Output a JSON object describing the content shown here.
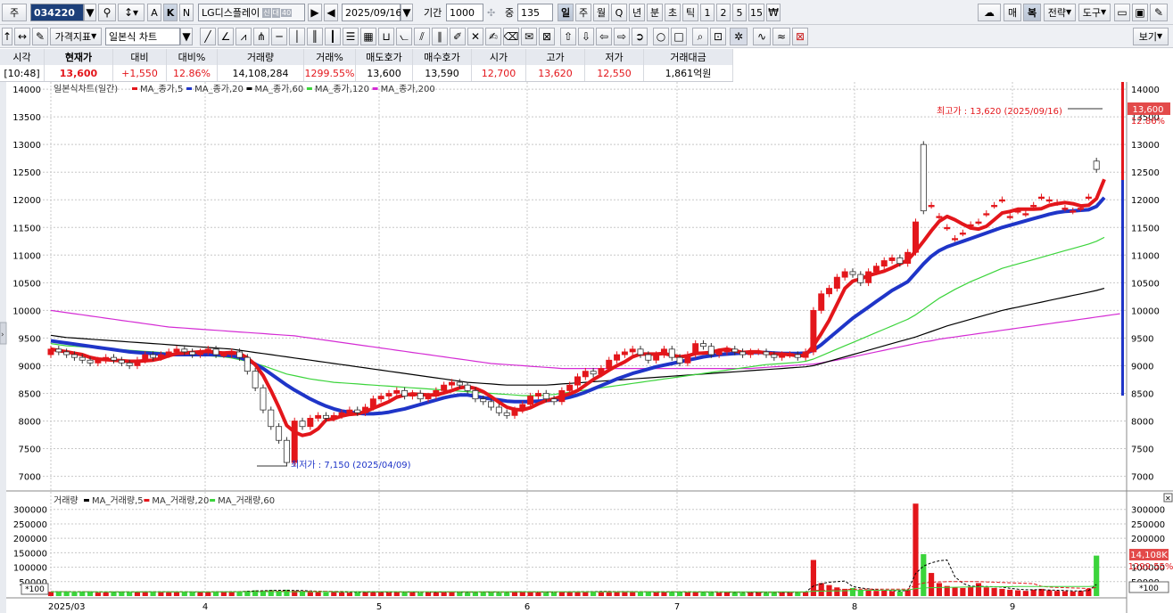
{
  "toolbar": {
    "mode_label": "주",
    "code": "034220",
    "name": "LG디스플레이",
    "name_badges": [
      "신",
      "대",
      "40"
    ],
    "date": "2025/09/16",
    "period_label": "기간",
    "period_value": "1000",
    "count_label": "중",
    "count_value": "135",
    "letters": [
      "A",
      "K",
      "N"
    ],
    "timeframes": [
      "일",
      "주",
      "월",
      "Q",
      "년",
      "분",
      "초",
      "틱",
      "1",
      "2",
      "5",
      "15"
    ],
    "right_buttons": [
      "매",
      "복",
      "전략",
      "도구"
    ],
    "view_button": "보기"
  },
  "toolbar2": {
    "indicator_button": "가격지표",
    "chart_select": "일본식 차트"
  },
  "quote": {
    "headers": [
      "시각",
      "현재가",
      "대비",
      "대비%",
      "거래량",
      "거래%",
      "매도호가",
      "매수호가",
      "시가",
      "고가",
      "저가",
      "거래대금"
    ],
    "values": [
      "[10:48]",
      "13,600",
      "+1,550",
      "12.86%",
      "14,108,284",
      "1299.55%",
      "13,600",
      "13,590",
      "12,700",
      "13,620",
      "12,550",
      "1,861억원"
    ]
  },
  "colors": {
    "up": "#e3161b",
    "down": "#1f35c8",
    "ma5": "#e3161b",
    "ma20": "#1f35c8",
    "ma60": "#3bd43b",
    "ma120": "#000000",
    "ma200": "#d42bd4",
    "grid": "#c8c8c8"
  },
  "price_panel": {
    "legend_title": "일본식차트(일간)",
    "legend_items": [
      "MA_종가,5",
      "MA_종가,20",
      "MA_종가,60",
      "MA_종가,120",
      "MA_종가,200"
    ],
    "y_ticks": [
      14000,
      13500,
      13000,
      12500,
      12000,
      11500,
      11000,
      10500,
      10000,
      9500,
      9000,
      8500,
      8000,
      7500,
      7000
    ],
    "high_annotation": "최고가 : 13,620 (2025/09/16)",
    "low_annotation": "최저가 : 7,150 (2025/04/09)",
    "last_price_tag": "13,600",
    "last_change_tag": "12.86%"
  },
  "volume_panel": {
    "legend_title": "거래량",
    "legend_items": [
      "MA_거래량,5",
      "MA_거래량,20",
      "MA_거래량,60"
    ],
    "y_ticks": [
      "300000",
      "250000",
      "200000",
      "150000",
      "100000",
      "50000"
    ],
    "unit_label": "*100",
    "volume_tag": "14,108K",
    "volume_pct_tag": "1299.55%"
  },
  "x_axis": {
    "labels": [
      "2025/03",
      "4",
      "5",
      "6",
      "7",
      "8",
      "9"
    ]
  },
  "chart_data": {
    "type": "candlestick",
    "x_start": "2025/03",
    "x_end": "2025/09/16",
    "ylim": [
      6800,
      14050
    ],
    "vol_ylim": [
      0,
      330000
    ],
    "closes": [
      9300,
      9250,
      9200,
      9150,
      9100,
      9050,
      9100,
      9150,
      9100,
      9050,
      9000,
      9100,
      9200,
      9150,
      9200,
      9250,
      9300,
      9250,
      9200,
      9250,
      9300,
      9200,
      9200,
      9250,
      9150,
      8900,
      8600,
      8200,
      7900,
      7650,
      7250,
      8000,
      7900,
      8050,
      8100,
      8050,
      8100,
      8150,
      8200,
      8150,
      8250,
      8400,
      8450,
      8500,
      8550,
      8450,
      8500,
      8400,
      8450,
      8550,
      8650,
      8700,
      8650,
      8550,
      8400,
      8350,
      8250,
      8150,
      8100,
      8200,
      8300,
      8450,
      8500,
      8400,
      8350,
      8550,
      8650,
      8800,
      8900,
      8850,
      8950,
      9100,
      9200,
      9250,
      9300,
      9200,
      9100,
      9200,
      9300,
      9150,
      9050,
      9200,
      9400,
      9350,
      9200,
      9250,
      9300,
      9250,
      9200,
      9250,
      9250,
      9200,
      9150,
      9200,
      9200,
      9150,
      9250,
      10000,
      10300,
      10400,
      10600,
      10700,
      10650,
      10500,
      10700,
      10800,
      10900,
      10950,
      10850,
      11050,
      11600,
      11800,
      11900,
      11700,
      11500,
      11300,
      11400,
      11550,
      11600,
      11750,
      11900,
      12000,
      11700,
      11800,
      11750,
      11900,
      12050,
      12000,
      11950,
      11850,
      11800,
      11850,
      12050,
      12550,
      13600
    ],
    "opens": [
      9200,
      9300,
      9250,
      9200,
      9150,
      9100,
      9050,
      9100,
      9150,
      9100,
      9050,
      9000,
      9100,
      9200,
      9150,
      9200,
      9250,
      9300,
      9250,
      9200,
      9250,
      9300,
      9200,
      9200,
      9250,
      9150,
      8900,
      8600,
      8200,
      7900,
      7650,
      7250,
      8000,
      7900,
      8050,
      8100,
      8050,
      8100,
      8150,
      8200,
      8150,
      8250,
      8400,
      8450,
      8500,
      8550,
      8450,
      8500,
      8400,
      8450,
      8550,
      8650,
      8700,
      8650,
      8550,
      8400,
      8350,
      8250,
      8150,
      8100,
      8200,
      8300,
      8450,
      8500,
      8400,
      8350,
      8550,
      8650,
      8800,
      8900,
      8850,
      8950,
      9100,
      9200,
      9250,
      9300,
      9200,
      9100,
      9200,
      9300,
      9150,
      9050,
      9200,
      9400,
      9350,
      9200,
      9250,
      9300,
      9250,
      9200,
      9250,
      9250,
      9200,
      9150,
      9200,
      9200,
      9150,
      9250,
      10000,
      10300,
      10400,
      10600,
      10700,
      10650,
      10500,
      10700,
      10800,
      10900,
      10950,
      10850,
      11050,
      13000,
      11900,
      11700,
      11500,
      11300,
      11400,
      11550,
      11600,
      11750,
      11900,
      12000,
      11700,
      11800,
      11750,
      11900,
      12050,
      12000,
      11950,
      11850,
      11800,
      11850,
      12050,
      12700
    ],
    "ma200": [
      10000,
      9980,
      9960,
      9940,
      9920,
      9900,
      9880,
      9860,
      9840,
      9820,
      9800,
      9780,
      9760,
      9740,
      9720,
      9700,
      9690,
      9680,
      9670,
      9660,
      9650,
      9640,
      9630,
      9620,
      9610,
      9600,
      9590,
      9580,
      9570,
      9560,
      9550,
      9540,
      9520,
      9500,
      9480,
      9460,
      9440,
      9420,
      9400,
      9380,
      9360,
      9340,
      9320,
      9300,
      9280,
      9260,
      9240,
      9220,
      9200,
      9180,
      9160,
      9140,
      9120,
      9100,
      9080,
      9060,
      9040,
      9030,
      9020,
      9010,
      9000,
      8990,
      8980,
      8970,
      8960,
      8950,
      8950,
      8950,
      8950,
      8950,
      8950,
      8950,
      8950,
      8950,
      8950,
      8950,
      8950,
      8950,
      8950,
      8950,
      8950,
      8950,
      8950,
      8950,
      8950,
      8950,
      8950,
      8950,
      8950,
      8950,
      8960,
      8970,
      8980,
      8990,
      9000,
      9010,
      9020,
      9030,
      9050,
      9080,
      9100,
      9130,
      9160,
      9190,
      9220,
      9250,
      9280,
      9310,
      9340,
      9370,
      9400,
      9430,
      9450,
      9480,
      9500,
      9520,
      9540,
      9560,
      9580,
      9600,
      9620,
      9640,
      9660,
      9680,
      9700,
      9720,
      9740,
      9760,
      9780,
      9800,
      9820,
      9840,
      9860,
      9880,
      9900,
      9920,
      9940
    ],
    "ma120": [
      9550,
      9530,
      9510,
      9500,
      9490,
      9480,
      9470,
      9460,
      9450,
      9440,
      9430,
      9420,
      9410,
      9400,
      9390,
      9380,
      9370,
      9360,
      9350,
      9340,
      9330,
      9320,
      9310,
      9300,
      9280,
      9260,
      9240,
      9220,
      9200,
      9180,
      9160,
      9140,
      9120,
      9100,
      9080,
      9060,
      9040,
      9020,
      9000,
      8980,
      8960,
      8940,
      8920,
      8900,
      8880,
      8860,
      8840,
      8820,
      8800,
      8780,
      8760,
      8740,
      8720,
      8700,
      8690,
      8680,
      8670,
      8660,
      8650,
      8650,
      8650,
      8650,
      8650,
      8650,
      8660,
      8670,
      8680,
      8690,
      8700,
      8710,
      8720,
      8730,
      8740,
      8750,
      8760,
      8770,
      8780,
      8790,
      8800,
      8810,
      8820,
      8830,
      8840,
      8850,
      8860,
      8870,
      8880,
      8890,
      8900,
      8910,
      8920,
      8930,
      8940,
      8950,
      8960,
      8970,
      8980,
      9000,
      9040,
      9080,
      9120,
      9160,
      9200,
      9240,
      9280,
      9320,
      9360,
      9400,
      9440,
      9480,
      9520,
      9570,
      9620,
      9670,
      9720,
      9760,
      9800,
      9840,
      9880,
      9920,
      9960,
      10000,
      10030,
      10060,
      10090,
      10120,
      10150,
      10180,
      10210,
      10240,
      10270,
      10300,
      10330,
      10360,
      10400
    ],
    "ma60": [
      9400,
      9380,
      9360,
      9350,
      9340,
      9330,
      9320,
      9310,
      9300,
      9290,
      9280,
      9270,
      9260,
      9250,
      9240,
      9230,
      9220,
      9210,
      9200,
      9190,
      9180,
      9170,
      9160,
      9140,
      9110,
      9080,
      9040,
      9000,
      8950,
      8900,
      8850,
      8820,
      8790,
      8760,
      8740,
      8720,
      8700,
      8690,
      8680,
      8670,
      8660,
      8650,
      8640,
      8630,
      8620,
      8610,
      8600,
      8590,
      8580,
      8570,
      8560,
      8550,
      8540,
      8530,
      8520,
      8510,
      8500,
      8490,
      8480,
      8470,
      8460,
      8460,
      8460,
      8470,
      8480,
      8500,
      8520,
      8540,
      8560,
      8580,
      8600,
      8620,
      8640,
      8660,
      8680,
      8700,
      8720,
      8740,
      8760,
      8780,
      8800,
      8820,
      8840,
      8860,
      8880,
      8900,
      8920,
      8940,
      8960,
      8980,
      9000,
      9020,
      9030,
      9040,
      9050,
      9060,
      9080,
      9120,
      9180,
      9240,
      9300,
      9360,
      9420,
      9480,
      9540,
      9600,
      9660,
      9720,
      9780,
      9840,
      9920,
      10020,
      10120,
      10220,
      10300,
      10380,
      10450,
      10520,
      10580,
      10640,
      10700,
      10760,
      10800,
      10840,
      10880,
      10920,
      10960,
      11000,
      11040,
      11080,
      11120,
      11160,
      11200,
      11250,
      11320
    ],
    "ma20": [
      9450,
      9430,
      9410,
      9390,
      9370,
      9350,
      9330,
      9310,
      9290,
      9270,
      9250,
      9240,
      9230,
      9220,
      9210,
      9200,
      9200,
      9200,
      9200,
      9200,
      9200,
      9200,
      9190,
      9180,
      9150,
      9100,
      9030,
      8950,
      8850,
      8750,
      8650,
      8560,
      8480,
      8400,
      8330,
      8270,
      8220,
      8180,
      8160,
      8140,
      8130,
      8130,
      8140,
      8160,
      8190,
      8220,
      8260,
      8300,
      8340,
      8380,
      8420,
      8450,
      8470,
      8470,
      8450,
      8420,
      8400,
      8380,
      8360,
      8350,
      8350,
      8350,
      8360,
      8370,
      8380,
      8400,
      8430,
      8470,
      8520,
      8580,
      8640,
      8700,
      8760,
      8810,
      8860,
      8900,
      8940,
      8980,
      9010,
      9040,
      9070,
      9100,
      9130,
      9160,
      9180,
      9200,
      9210,
      9220,
      9230,
      9240,
      9240,
      9240,
      9230,
      9220,
      9220,
      9220,
      9230,
      9280,
      9380,
      9500,
      9620,
      9740,
      9860,
      9960,
      10060,
      10160,
      10260,
      10360,
      10440,
      10520,
      10680,
      10840,
      10980,
      11080,
      11150,
      11200,
      11250,
      11300,
      11350,
      11400,
      11450,
      11500,
      11540,
      11580,
      11620,
      11660,
      11700,
      11740,
      11770,
      11790,
      11800,
      11810,
      11820,
      11880,
      12040
    ],
    "volumes": [
      15000,
      14000,
      16000,
      13000,
      15000,
      14000,
      12000,
      13000,
      14000,
      15000,
      13000,
      14000,
      16000,
      15000,
      14000,
      13000,
      15000,
      14000,
      13000,
      14000,
      15000,
      16000,
      14000,
      15000,
      17000,
      18000,
      20000,
      19000,
      21000,
      18000,
      22000,
      19000,
      16000,
      15000,
      14000,
      13000,
      14000,
      13000,
      12000,
      13000,
      14000,
      15000,
      14000,
      13000,
      14000,
      15000,
      13000,
      12000,
      13000,
      14000,
      15000,
      14000,
      13000,
      12000,
      14000,
      15000,
      13000,
      12000,
      14000,
      16000,
      15000,
      14000,
      13000,
      12000,
      13000,
      14000,
      16000,
      15000,
      14000,
      15000,
      16000,
      17000,
      15000,
      14000,
      16000,
      15000,
      14000,
      13000,
      14000,
      15000,
      14000,
      13000,
      14000,
      15000,
      13000,
      12000,
      14000,
      13000,
      12000,
      14000,
      13000,
      12000,
      14000,
      13000,
      12000,
      14000,
      15000,
      125000,
      45000,
      38000,
      30000,
      25000,
      28000,
      22000,
      20000,
      18000,
      19000,
      17000,
      16000,
      22000,
      320000,
      145000,
      80000,
      45000,
      35000,
      30000,
      28000,
      32000,
      45000,
      30000,
      28000,
      25000,
      22000,
      20000,
      18000,
      22000,
      25000,
      20000,
      18000,
      17000,
      16000,
      18000,
      25000,
      140000
    ],
    "vol_ma5": [
      15000,
      15000,
      15000,
      14500,
      14500,
      14500,
      14000,
      14000,
      14000,
      14000,
      14000,
      14000,
      14500,
      14500,
      14500,
      14500,
      14500,
      14500,
      14000,
      14000,
      14000,
      14500,
      14500,
      15000,
      15500,
      16500,
      17500,
      18500,
      19500,
      20000,
      20000,
      19500,
      19000,
      18000,
      17000,
      15500,
      14500,
      14000,
      13500,
      13500,
      13500,
      14000,
      14000,
      14000,
      14000,
      14000,
      14000,
      13500,
      13500,
      13500,
      14000,
      14000,
      13500,
      13500,
      13500,
      14000,
      14000,
      13500,
      13500,
      14500,
      15000,
      14500,
      14000,
      13500,
      13500,
      14000,
      14500,
      15000,
      15000,
      15500,
      16000,
      16000,
      15500,
      15500,
      15500,
      15000,
      14500,
      14000,
      14000,
      14500,
      14000,
      14000,
      14000,
      14000,
      13500,
      13500,
      13500,
      13000,
      13000,
      13000,
      13000,
      13000,
      13000,
      13000,
      13000,
      13500,
      14000,
      35000,
      43000,
      48000,
      50000,
      52000,
      33000,
      28000,
      25000,
      22000,
      20000,
      19000,
      18000,
      19000,
      78000,
      104000,
      115000,
      122000,
      125000,
      67000,
      44000,
      34000,
      34000,
      33000,
      32000,
      31000,
      27000,
      24000,
      22000,
      22000,
      22000,
      21000,
      20000,
      19000,
      18000,
      18000,
      19000,
      40000
    ],
    "vol_ma20": [
      15000,
      15000,
      15000,
      15000,
      15000,
      15000,
      14500,
      14500,
      14500,
      14500,
      14500,
      14500,
      14500,
      14500,
      14500,
      14500,
      14500,
      14500,
      14500,
      14500,
      14500,
      14500,
      14500,
      14500,
      15000,
      15000,
      15500,
      16000,
      16500,
      16500,
      17000,
      17000,
      17000,
      17000,
      16500,
      16500,
      16000,
      16000,
      15500,
      15500,
      15000,
      15000,
      14500,
      14500,
      14500,
      14000,
      14000,
      14000,
      14000,
      14000,
      14000,
      14000,
      14000,
      14000,
      14000,
      14000,
      14000,
      14000,
      14000,
      14000,
      14000,
      14000,
      14000,
      14000,
      14000,
      14000,
      14000,
      14500,
      14500,
      14500,
      14500,
      15000,
      15000,
      15000,
      15000,
      15000,
      15000,
      15000,
      15000,
      15000,
      15000,
      15000,
      14500,
      14500,
      14500,
      14500,
      14000,
      14000,
      14000,
      14000,
      14000,
      13500,
      13500,
      13500,
      13500,
      13500,
      13500,
      19000,
      20000,
      21000,
      22000,
      23000,
      23500,
      24000,
      24000,
      24000,
      24000,
      24000,
      24000,
      24000,
      39000,
      45000,
      48000,
      49000,
      50000,
      50000,
      50000,
      50000,
      50000,
      49000,
      48000,
      47000,
      46000,
      45000,
      44000,
      43000,
      34000,
      31000,
      30000,
      29000,
      28000,
      27000,
      26000,
      30000
    ],
    "vol_ma60": [
      14500,
      14500,
      14500,
      14500,
      14500,
      14500,
      14500,
      14500,
      14500,
      14500,
      14500,
      14500,
      14500,
      14500,
      14500,
      14500,
      14500,
      14500,
      14500,
      14500,
      14500,
      14500,
      14500,
      14500,
      14500,
      14500,
      14500,
      15000,
      15000,
      15000,
      15000,
      15000,
      15000,
      15000,
      15000,
      15000,
      15000,
      15000,
      15000,
      15000,
      15000,
      15000,
      15000,
      15000,
      15000,
      15000,
      15000,
      15000,
      15000,
      15000,
      15000,
      15000,
      15000,
      15000,
      15000,
      15000,
      15000,
      15000,
      15000,
      15000,
      15000,
      15000,
      15000,
      15000,
      15000,
      15000,
      14500,
      14500,
      14500,
      14500,
      14500,
      14500,
      14500,
      14500,
      14500,
      14500,
      14500,
      14500,
      14500,
      14500,
      14500,
      14500,
      14500,
      14500,
      14500,
      14500,
      14500,
      14500,
      14500,
      14500,
      14500,
      14500,
      14500,
      14500,
      14500,
      14500,
      14500,
      16500,
      17000,
      17500,
      18000,
      18500,
      19000,
      19500,
      20000,
      20000,
      20500,
      20500,
      21000,
      21000,
      26000,
      28000,
      29000,
      29500,
      30000,
      30500,
      31000,
      31500,
      32000,
      32000,
      32000,
      32500,
      32500,
      33000,
      33000,
      33000,
      33000,
      33000,
      33000,
      33000,
      33000,
      33000,
      33000,
      35000
    ]
  }
}
